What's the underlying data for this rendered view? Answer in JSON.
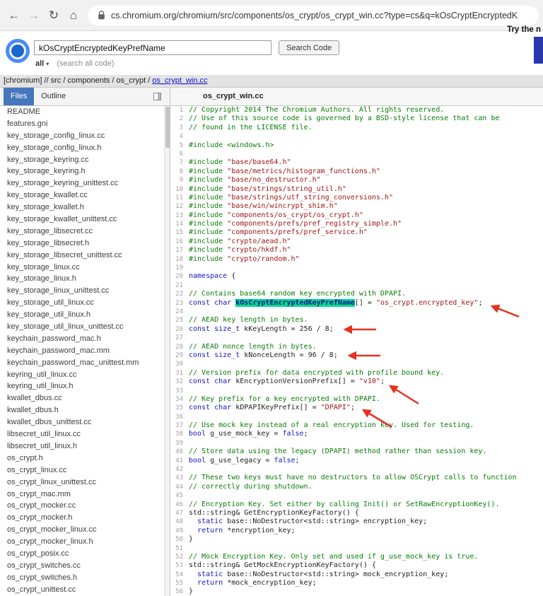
{
  "browser": {
    "url": "cs.chromium.org/chromium/src/components/os_crypt/os_crypt_win.cc?type=cs&q=kOsCryptEncryptedK",
    "icons": {
      "back": "←",
      "forward": "→",
      "refresh": "↻",
      "home": "⌂"
    }
  },
  "promo": {
    "text": "Try the n"
  },
  "search": {
    "query": "kOsCryptEncryptedKeyPrefName",
    "button_label": "Search Code",
    "scope": "all",
    "scope_caret": "▾",
    "scope_hint": "(search all code)"
  },
  "breadcrumb": {
    "prefix": "[chromium] // src / components / os_crypt / ",
    "file_link": "os_crypt_win.cc"
  },
  "sidebar": {
    "tabs": {
      "files": "Files",
      "outline": "Outline"
    },
    "files": [
      "README",
      "features.gni",
      "key_storage_config_linux.cc",
      "key_storage_config_linux.h",
      "key_storage_keyring.cc",
      "key_storage_keyring.h",
      "key_storage_keyring_unittest.cc",
      "key_storage_kwallet.cc",
      "key_storage_kwallet.h",
      "key_storage_kwallet_unittest.cc",
      "key_storage_libsecret.cc",
      "key_storage_libsecret.h",
      "key_storage_libsecret_unittest.cc",
      "key_storage_linux.cc",
      "key_storage_linux.h",
      "key_storage_linux_unittest.cc",
      "key_storage_util_linux.cc",
      "key_storage_util_linux.h",
      "key_storage_util_linux_unittest.cc",
      "keychain_password_mac.h",
      "keychain_password_mac.mm",
      "keychain_password_mac_unittest.mm",
      "keyring_util_linux.cc",
      "keyring_util_linux.h",
      "kwallet_dbus.cc",
      "kwallet_dbus.h",
      "kwallet_dbus_unittest.cc",
      "libsecret_util_linux.cc",
      "libsecret_util_linux.h",
      "os_crypt.h",
      "os_crypt_linux.cc",
      "os_crypt_linux_unittest.cc",
      "os_crypt_mac.mm",
      "os_crypt_mocker.cc",
      "os_crypt_mocker.h",
      "os_crypt_mocker_linux.cc",
      "os_crypt_mocker_linux.h",
      "os_crypt_posix.cc",
      "os_crypt_switches.cc",
      "os_crypt_switches.h",
      "os_crypt_unittest.cc"
    ]
  },
  "main": {
    "title": "os_crypt_win.cc"
  },
  "code": {
    "lines": [
      [
        [
          "c",
          "// Copyright 2014 The Chromium Authors. All rights reserved."
        ]
      ],
      [
        [
          "c",
          "// Use of this source code is governed by a BSD-style license that can be"
        ]
      ],
      [
        [
          "c",
          "// found in the LICENSE file."
        ]
      ],
      [],
      [
        [
          "d",
          "#include <windows.h>"
        ]
      ],
      [],
      [
        [
          "d",
          "#include "
        ],
        [
          "s",
          "\"base/base64.h\""
        ]
      ],
      [
        [
          "d",
          "#include "
        ],
        [
          "s",
          "\"base/metrics/histogram_functions.h\""
        ]
      ],
      [
        [
          "d",
          "#include "
        ],
        [
          "s",
          "\"base/no_destructor.h\""
        ]
      ],
      [
        [
          "d",
          "#include "
        ],
        [
          "s",
          "\"base/strings/string_util.h\""
        ]
      ],
      [
        [
          "d",
          "#include "
        ],
        [
          "s",
          "\"base/strings/utf_string_conversions.h\""
        ]
      ],
      [
        [
          "d",
          "#include "
        ],
        [
          "s",
          "\"base/win/wincrypt_shim.h\""
        ]
      ],
      [
        [
          "d",
          "#include "
        ],
        [
          "s",
          "\"components/os_crypt/os_crypt.h\""
        ]
      ],
      [
        [
          "d",
          "#include "
        ],
        [
          "s",
          "\"components/prefs/pref_registry_simple.h\""
        ]
      ],
      [
        [
          "d",
          "#include "
        ],
        [
          "s",
          "\"components/prefs/pref_service.h\""
        ]
      ],
      [
        [
          "d",
          "#include "
        ],
        [
          "s",
          "\"crypto/aead.h\""
        ]
      ],
      [
        [
          "d",
          "#include "
        ],
        [
          "s",
          "\"crypto/hkdf.h\""
        ]
      ],
      [
        [
          "d",
          "#include "
        ],
        [
          "s",
          "\"crypto/random.h\""
        ]
      ],
      [],
      [
        [
          "k",
          "namespace"
        ],
        [
          "p",
          " {"
        ]
      ],
      [],
      [
        [
          "c",
          "// Contains base64 random key encrypted with DPAPI."
        ]
      ],
      [
        [
          "k",
          "const char"
        ],
        [
          "p",
          " "
        ],
        [
          "hl",
          "kOsCryptEncryptedKeyPrefName"
        ],
        [
          "p",
          "[] = "
        ],
        [
          "s",
          "\"os_crypt.encrypted_key\""
        ],
        [
          "p",
          ";"
        ]
      ],
      [],
      [
        [
          "c",
          "// AEAD key length in bytes."
        ]
      ],
      [
        [
          "k",
          "const size_t"
        ],
        [
          "p",
          " kKeyLength = 256 / 8;"
        ]
      ],
      [],
      [
        [
          "c",
          "// AEAD nonce length in bytes."
        ]
      ],
      [
        [
          "k",
          "const size_t"
        ],
        [
          "p",
          " kNonceLength = 96 / 8;"
        ]
      ],
      [],
      [
        [
          "c",
          "// Version prefix for data encrypted with profile bound key."
        ]
      ],
      [
        [
          "k",
          "const char"
        ],
        [
          "p",
          " kEncryptionVersionPrefix[] = "
        ],
        [
          "s",
          "\"v10\""
        ],
        [
          "p",
          ";"
        ]
      ],
      [],
      [
        [
          "c",
          "// Key prefix for a key encrypted with DPAPI."
        ]
      ],
      [
        [
          "k",
          "const char"
        ],
        [
          "p",
          " kDPAPIKeyPrefix[] = "
        ],
        [
          "s",
          "\"DPAPI\""
        ],
        [
          "p",
          ";"
        ]
      ],
      [],
      [
        [
          "c",
          "// Use mock key instead of a real encryption key. Used for testing."
        ]
      ],
      [
        [
          "k",
          "bool"
        ],
        [
          "p",
          " g_use_mock_key = "
        ],
        [
          "k",
          "false"
        ],
        [
          "p",
          ";"
        ]
      ],
      [],
      [
        [
          "c",
          "// Store data using the legacy (DPAPI) method rather than session key."
        ]
      ],
      [
        [
          "k",
          "bool"
        ],
        [
          "p",
          " g_use_legacy = "
        ],
        [
          "k",
          "false"
        ],
        [
          "p",
          ";"
        ]
      ],
      [],
      [
        [
          "c",
          "// These two keys must have no destructors to allow OSCrypt calls to function"
        ]
      ],
      [
        [
          "c",
          "// correctly during shutdown."
        ]
      ],
      [],
      [
        [
          "c",
          "// Encryption Key. Set either by calling Init() or SetRawEncryptionKey()."
        ]
      ],
      [
        [
          "p",
          "std::string& GetEncryptionKeyFactory() {"
        ]
      ],
      [
        [
          "p",
          "  "
        ],
        [
          "k",
          "static"
        ],
        [
          "p",
          " base::NoDestructor<std::string> encryption_key;"
        ]
      ],
      [
        [
          "p",
          "  "
        ],
        [
          "k",
          "return"
        ],
        [
          "p",
          " *encryption_key;"
        ]
      ],
      [
        [
          "p",
          "}"
        ]
      ],
      [],
      [
        [
          "c",
          "// Mock Encryption Key. Only set and used if g_use_mock_key is true."
        ]
      ],
      [
        [
          "p",
          "std::string& GetMockEncryptionKeyFactory() {"
        ]
      ],
      [
        [
          "p",
          "  "
        ],
        [
          "k",
          "static"
        ],
        [
          "p",
          " base::NoDestructor<std::string> mock_encryption_key;"
        ]
      ],
      [
        [
          "p",
          "  "
        ],
        [
          "k",
          "return"
        ],
        [
          "p",
          " *mock_encryption_key;"
        ]
      ],
      [
        [
          "p",
          "}"
        ]
      ]
    ]
  },
  "annotations": {
    "color": "#e8301e",
    "arrows": [
      [
        734,
        448,
        696,
        433
      ],
      [
        532,
        466,
        488,
        466
      ],
      [
        538,
        503,
        494,
        503
      ],
      [
        592,
        571,
        552,
        546
      ],
      [
        554,
        604,
        514,
        580
      ]
    ]
  }
}
